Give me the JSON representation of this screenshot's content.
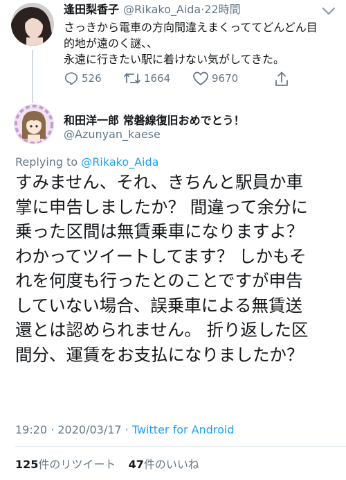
{
  "parent_tweet": {
    "display_name": "逢田梨香子",
    "handle": "@Rikako_Aida",
    "time_sep": "·",
    "time": "22時間",
    "text_lines": [
      "さっきから電車の方向間違えまくっててどんどん目",
      "的地が遠のく謎、、",
      "永遠に行きたい駅に着けない気がしてきた。"
    ],
    "replies": "526",
    "retweets": "1664",
    "likes": "9670"
  },
  "main_tweet": {
    "display_name": "和田洋一郎 常磐線復旧おめでとう！",
    "handle": "@Azunyan_kaese",
    "replying_prefix": "Replying to",
    "replying_to": "@Rikako_Aida",
    "text_lines": [
      "すみません、それ、きちんと駅員か車",
      "掌に申告しましたか？ 間違って余分に",
      "乗った区間は無賃乗車になりますよ？",
      "わかってツイートしてます？ しかもそ",
      "れを何度も行ったとのことですが申告",
      "していない場合、誤乗車による無賃送",
      "還とは認められません。 折り返した区",
      "間分、運賃をお支払になりましたか？"
    ],
    "timestamp": "19:20 · 2020/03/17 ·",
    "client": "Twitter for Android",
    "retweet_count": "125",
    "retweet_label": "件のリツイート",
    "like_count": "47",
    "like_label": "件のいいね"
  },
  "icons": {
    "reply": "reply-icon",
    "retweet": "retweet-icon",
    "like": "heart-icon",
    "share": "share-icon",
    "more": "chevron-down-icon"
  },
  "colors": {
    "text": "#14171a",
    "muted": "#657786",
    "link": "#1da1f2",
    "thread_line": "#cfd9de"
  }
}
